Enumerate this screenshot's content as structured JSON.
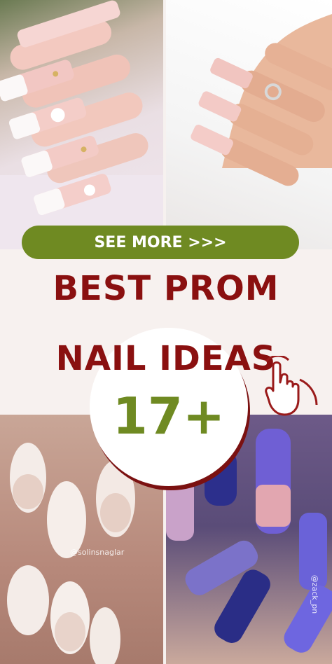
{
  "cta": {
    "label": "SEE MORE >>>"
  },
  "headline": {
    "line1": "BEST PROM",
    "line2": "NAIL IDEAS"
  },
  "count": "17+",
  "watermarks": {
    "bottom_left": "@solinsnaglar",
    "bottom_right": "@zack_pn"
  },
  "icons": {
    "cursor": "pointing-hand-icon"
  },
  "colors": {
    "accent_green": "#6f8a22",
    "headline_red": "#8a1010",
    "banner_bg": "#f7f1ef"
  }
}
